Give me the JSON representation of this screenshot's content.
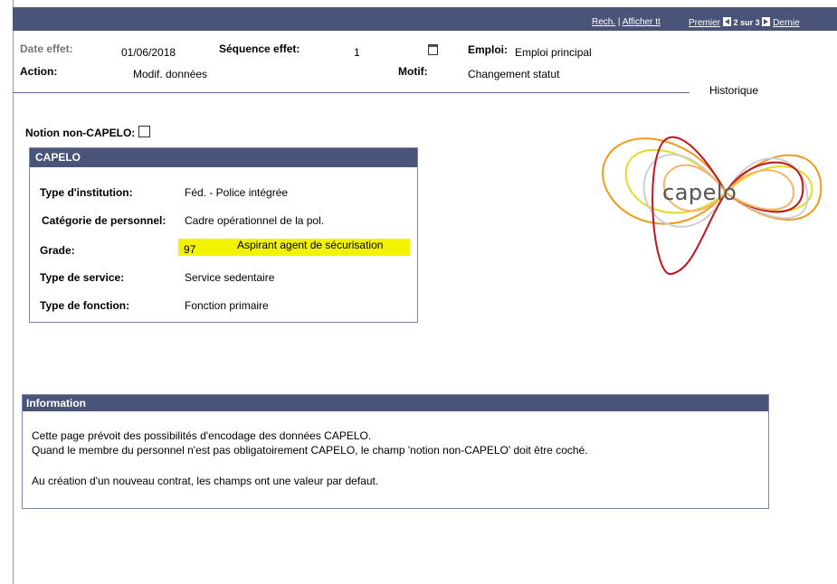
{
  "nav": {
    "search": "Rech.",
    "sep": "|",
    "show_all": "Afficher tt",
    "first": "Premier",
    "counter": "2 sur 3",
    "last": "Dernie"
  },
  "header": {
    "date_label": "Date effet:",
    "date_value": "01/06/2018",
    "seq_label": "Séquence effet:",
    "seq_value": "1",
    "emploi_label": "Emploi:",
    "emploi_value": "Emploi principal",
    "action_label": "Action:",
    "action_value": "Modif. données",
    "motif_label": "Motif:",
    "motif_value": "Changement statut",
    "history": "Historique"
  },
  "notion": {
    "label": "Notion non-CAPELO:",
    "checked": false
  },
  "capelo": {
    "title": "CAPELO",
    "rows": [
      {
        "label": "Type d'institution:",
        "value": "Féd. - Police intégrée"
      },
      {
        "label": "Catégorie de personnel:",
        "value": "Cadre opérationnel de la pol."
      },
      {
        "label": "Grade:",
        "code": "97",
        "value": "Aspirant agent de sécurisation"
      },
      {
        "label": "Type de service:",
        "value": "Service sedentaire"
      },
      {
        "label": "Type de fonction:",
        "value": "Fonction primaire"
      }
    ]
  },
  "info": {
    "title": "Information",
    "line1": "Cette page prévoit des possibilités d'encodage des données CAPELO.",
    "line2": "Quand le membre du personnel n'est pas obligatoirement CAPELO, le champ 'notion non-CAPELO' doit être coché.",
    "line3": "Au création d'un nouveau contrat, les champs ont une valeur par defaut."
  },
  "logo": {
    "text": "capelo"
  },
  "colors": {
    "header_bar": "#4a5478",
    "highlight": "#f3f300",
    "logo_red": "#c0141e",
    "logo_orange": "#f29a1e",
    "logo_yellow": "#e0dc2a"
  }
}
